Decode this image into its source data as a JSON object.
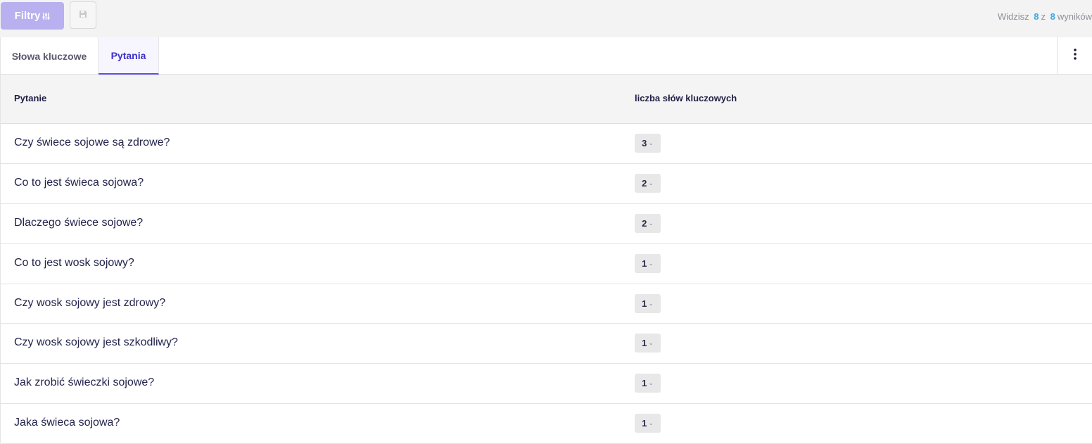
{
  "toolbar": {
    "filters_label": "Filtry",
    "results": {
      "prefix": "Widzisz",
      "shown": "8",
      "middle": "z",
      "total": "8",
      "suffix": "wyników"
    }
  },
  "tabs": [
    {
      "label": "Słowa kluczowe",
      "active": false
    },
    {
      "label": "Pytania",
      "active": true
    }
  ],
  "table": {
    "headers": {
      "question": "Pytanie",
      "count": "liczba słów kluczowych"
    },
    "rows": [
      {
        "question": "Czy świece sojowe są zdrowe?",
        "count": "3"
      },
      {
        "question": "Co to jest świeca sojowa?",
        "count": "2"
      },
      {
        "question": "Dlaczego świece sojowe?",
        "count": "2"
      },
      {
        "question": "Co to jest wosk sojowy?",
        "count": "1"
      },
      {
        "question": "Czy wosk sojowy jest zdrowy?",
        "count": "1"
      },
      {
        "question": "Czy wosk sojowy jest szkodliwy?",
        "count": "1"
      },
      {
        "question": "Jak zrobić świeczki sojowe?",
        "count": "1"
      },
      {
        "question": "Jaka świeca sojowa?",
        "count": "1"
      }
    ]
  },
  "colors": {
    "accent": "#5b4de6",
    "filters_button": "#b9b0ef",
    "results_number": "#3aa9e6"
  },
  "icons": {
    "filters": "sliders-icon",
    "save": "floppy-disk-icon",
    "menu": "vertical-dots-icon",
    "dropdown": "chevron-down-icon"
  }
}
